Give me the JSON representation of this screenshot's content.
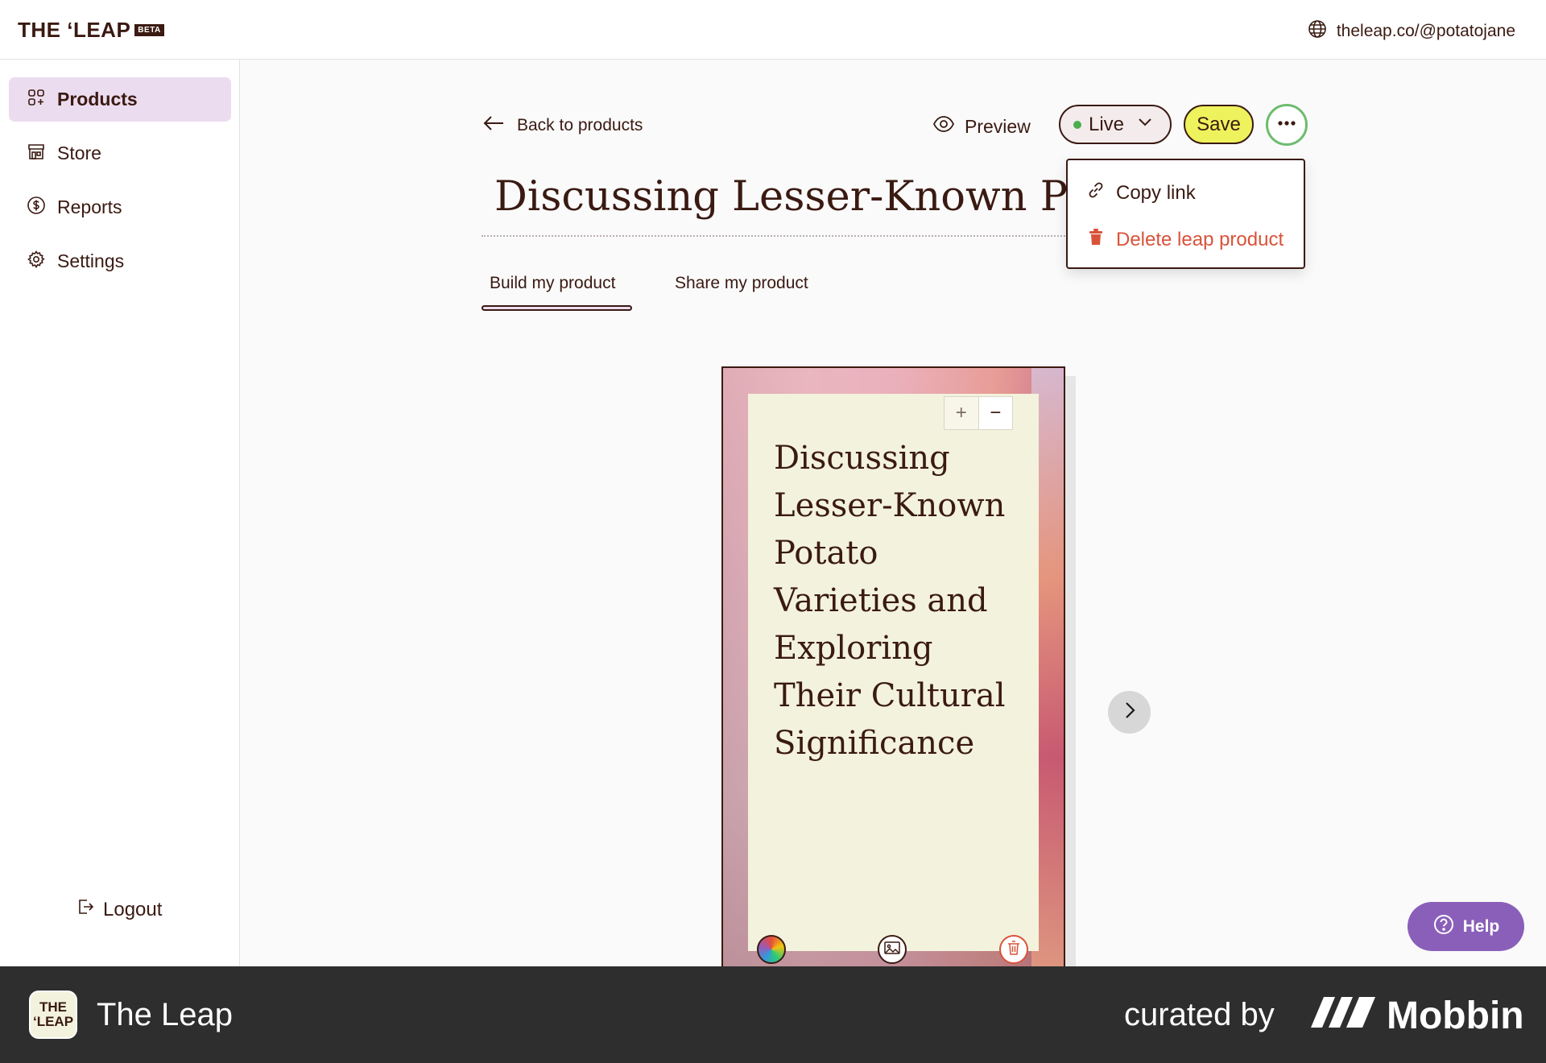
{
  "header": {
    "logo_text": "THE ‘LEAP",
    "beta_badge": "BETA",
    "site_url": "theleap.co/@potatojane"
  },
  "sidebar": {
    "items": [
      {
        "label": "Products",
        "icon": "products-grid-icon",
        "active": true
      },
      {
        "label": "Store",
        "icon": "store-icon",
        "active": false
      },
      {
        "label": "Reports",
        "icon": "dollar-icon",
        "active": false
      },
      {
        "label": "Settings",
        "icon": "gear-icon",
        "active": false
      }
    ],
    "logout_label": "Logout"
  },
  "toolbar": {
    "back_label": "Back to products",
    "preview_label": "Preview",
    "status_label": "Live",
    "status_color": "#4cae4c",
    "save_label": "Save"
  },
  "product": {
    "title": "Discussing Lesser-Known Potato Varieties and Exploring Their Cultural Significance"
  },
  "tabs": [
    {
      "label": "Build my product",
      "active": true
    },
    {
      "label": "Share my product",
      "active": false
    }
  ],
  "dropdown": {
    "copy_link_label": "Copy link",
    "delete_label": "Delete leap product",
    "delete_color": "#d9533a"
  },
  "card": {
    "zoom_in": "+",
    "zoom_out": "−",
    "text": "Discussing Lesser-Known Potato Varieties and Exploring Their Cultural Significance"
  },
  "help": {
    "label": "Help",
    "color": "#8a5fb9"
  },
  "footer": {
    "app_icon_line1": "THE",
    "app_icon_line2": "‘LEAP",
    "app_name": "The Leap",
    "curated_by": "curated by",
    "brand": "Mobbin"
  },
  "colors": {
    "accent_purple": "#ecdcef",
    "save_yellow": "#eef25c",
    "text_brown": "#3a1a12"
  }
}
